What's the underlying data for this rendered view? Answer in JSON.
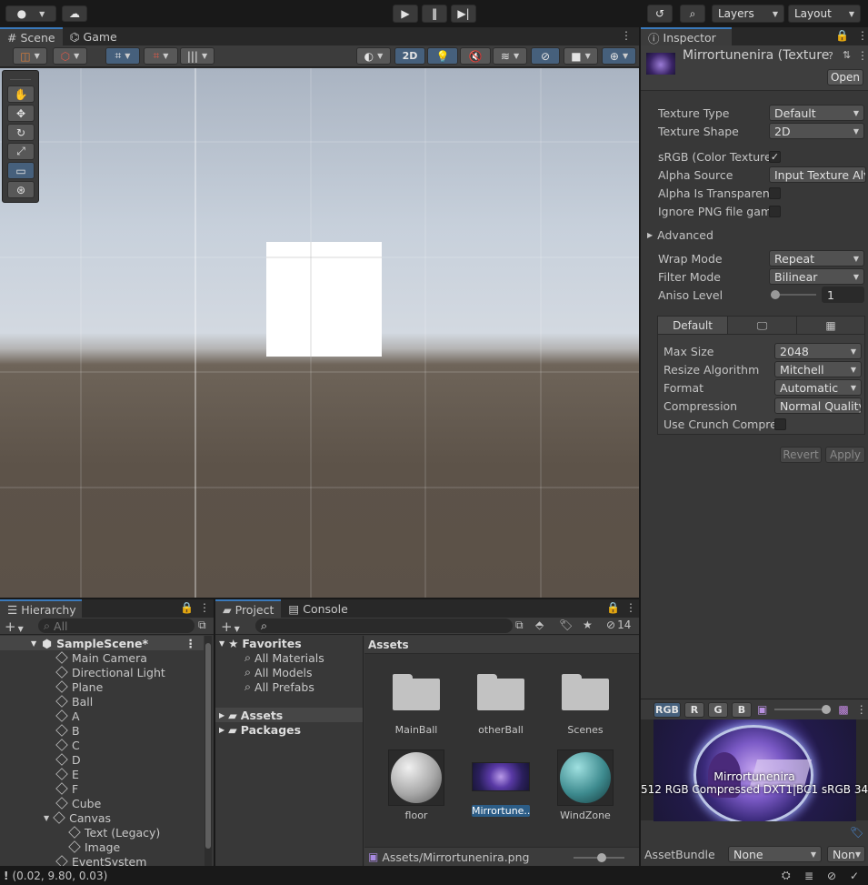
{
  "toolbar": {
    "account_icon": "account-icon",
    "cloud_icon": "cloud-icon",
    "play_icon": "play-icon",
    "pause_icon": "pause-icon",
    "step_icon": "step-icon",
    "history_icon": "history-icon",
    "search_icon": "search-icon",
    "layers_label": "Layers",
    "layout_label": "Layout"
  },
  "scene_panel": {
    "tabs": [
      "Scene",
      "Game"
    ],
    "btn_2d": "2D",
    "tools": [
      "hand-tool-icon",
      "move-tool-icon",
      "rotate-tool-icon",
      "scale-tool-icon",
      "rect-tool-icon",
      "transform-tool-icon"
    ]
  },
  "inspector": {
    "tab": "Inspector",
    "asset_title": "Mirrortunenira (Texture",
    "open_label": "Open",
    "rows": [
      {
        "label": "Texture Type",
        "value": "Default"
      },
      {
        "label": "Texture Shape",
        "value": "2D"
      },
      {
        "label": "sRGB (Color Texture)",
        "value": "✓"
      },
      {
        "label": "Alpha Source",
        "value": "Input Texture Al"
      },
      {
        "label": "Alpha Is Transparenc",
        "value": ""
      },
      {
        "label": "Ignore PNG file gamm",
        "value": ""
      }
    ],
    "advanced_label": "Advanced",
    "wrap_label": "Wrap Mode",
    "wrap_value": "Repeat",
    "filter_label": "Filter Mode",
    "filter_value": "Bilinear",
    "aniso_label": "Aniso Level",
    "aniso_value": "1",
    "platform_tab": "Default",
    "platform_rows": [
      {
        "label": "Max Size",
        "value": "2048"
      },
      {
        "label": "Resize Algorithm",
        "value": "Mitchell"
      },
      {
        "label": "Format",
        "value": "Automatic"
      },
      {
        "label": "Compression",
        "value": "Normal Quality"
      }
    ],
    "crunch_label": "Use Crunch Compres",
    "revert_label": "Revert",
    "apply_label": "Apply",
    "preview_channels": [
      "RGB",
      "R",
      "G",
      "B"
    ],
    "preview_name": "Mirrortunenira",
    "preview_info": "512  RGB Compressed DXT1|BC1 sRGB  34",
    "assetbundle_label": "AssetBundle",
    "assetbundle_value": "None",
    "assetbundle_variant": "Non"
  },
  "hierarchy": {
    "tab": "Hierarchy",
    "search_placeholder": "All",
    "scene_name": "SampleScene*",
    "items": [
      "Main Camera",
      "Directional Light",
      "Plane",
      "Ball",
      "A",
      "B",
      "C",
      "D",
      "E",
      "F",
      "Cube",
      "Canvas",
      "Text (Legacy)",
      "Image",
      "EventSystem"
    ]
  },
  "project": {
    "tabs": [
      "Project",
      "Console"
    ],
    "hidden_count": "14",
    "favorites_label": "Favorites",
    "favorites": [
      "All Materials",
      "All Models",
      "All Prefabs"
    ],
    "tree": [
      "Assets",
      "Packages"
    ],
    "breadcrumb": "Assets",
    "assets": [
      {
        "name": "MainBall",
        "kind": "folder"
      },
      {
        "name": "otherBall",
        "kind": "folder"
      },
      {
        "name": "Scenes",
        "kind": "folder"
      },
      {
        "name": "floor",
        "kind": "material-grey"
      },
      {
        "name": "Mirrortune...",
        "kind": "texture"
      },
      {
        "name": "WindZone",
        "kind": "material-teal"
      }
    ],
    "footer_path": "Assets/Mirrortunenira.png"
  },
  "status": {
    "coords": "(0.02, 9.80, 0.03)"
  },
  "colors": {
    "accent": "#3a79bb",
    "selected": "#2c5d87",
    "panel": "#383838",
    "sky": "#b9c4d1",
    "ground": "#5a5048"
  }
}
